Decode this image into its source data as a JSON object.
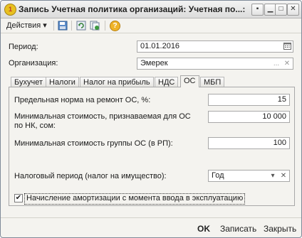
{
  "window": {
    "title": "Запись Учетная политика организаций: Учетная по...: ...",
    "title_display": "Запись Учетная политика организаций: Учетная по...:",
    "controls": {
      "menu": "▪",
      "minimize": "▁",
      "maximize": "□",
      "close": "✕"
    }
  },
  "toolbar": {
    "actions_label": "Действия",
    "actions_arrow": "▾",
    "icons": [
      "save-copy-icon",
      "refresh-icon",
      "new-copy-icon",
      "help-icon"
    ],
    "help_glyph": "?"
  },
  "form": {
    "period_label": "Период:",
    "period_value": "01.01.2016",
    "org_label": "Организация:",
    "org_value": "Эмерек",
    "org_select_glyph": "...",
    "org_clear_glyph": "✕"
  },
  "tabs": [
    {
      "label": "Бухучет",
      "active": false
    },
    {
      "label": "Налоги",
      "active": false
    },
    {
      "label": "Налог на прибыль",
      "active": false
    },
    {
      "label": "НДС",
      "active": false
    },
    {
      "label": "ОС",
      "active": true
    },
    {
      "label": "МБП",
      "active": false
    }
  ],
  "os_tab": {
    "repair_norm_label": "Предельная норма на ремонт ОС, %:",
    "repair_norm_value": "15",
    "min_cost_label_line1": "Минимальная стоимость, признаваемая для ОС",
    "min_cost_label_line2": "по НК, сом:",
    "min_cost_value": "10 000",
    "min_group_cost_label": "Минимальная стоимость группы ОС (в РП):",
    "min_group_cost_value": "100",
    "tax_period_label": "Налоговый период (налог на имущество):",
    "tax_period_value": "Год",
    "tax_period_arrow": "▾",
    "tax_period_clear": "✕",
    "depreciation_checked": true,
    "depreciation_check_glyph": "✔",
    "depreciation_label": "Начисление амортизации с момента ввода в эксплуатацию"
  },
  "bottom": {
    "ok_label": "OK",
    "save_label": "Записать",
    "close_label": "Закрыть"
  }
}
